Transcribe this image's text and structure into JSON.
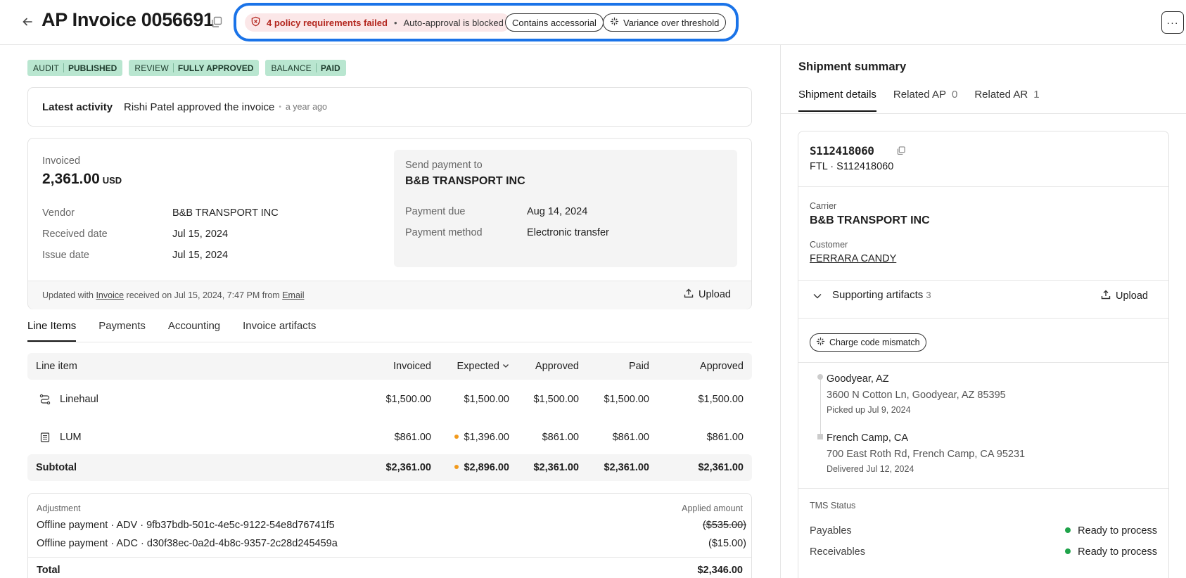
{
  "header": {
    "title": "AP Invoice 0056691",
    "policy_failed": "4 policy requirements failed",
    "auto_approval": "Auto-approval is blocked",
    "chip_accessorial": "Contains accessorial",
    "chip_variance": "Variance over threshold",
    "more_label": "···"
  },
  "badges": [
    {
      "key": "AUDIT",
      "value": "PUBLISHED"
    },
    {
      "key": "REVIEW",
      "value": "FULLY APPROVED"
    },
    {
      "key": "BALANCE",
      "value": "PAID"
    }
  ],
  "activity": {
    "label": "Latest activity",
    "text": "Rishi Patel approved the invoice",
    "time": "a year ago"
  },
  "invoice": {
    "invoiced_label": "Invoiced",
    "amount": "2,361.00",
    "currency": "USD",
    "vendor_label": "Vendor",
    "vendor": "B&B TRANSPORT INC",
    "received_label": "Received date",
    "received": "Jul 15, 2024",
    "issue_label": "Issue date",
    "issue": "Jul 15, 2024",
    "send_to_label": "Send payment to",
    "send_to": "B&B TRANSPORT INC",
    "due_label": "Payment due",
    "due": "Aug 14, 2024",
    "method_label": "Payment method",
    "method": "Electronic transfer",
    "updated_prefix": "Updated with",
    "updated_link": "Invoice",
    "updated_mid": "received on Jul 15, 2024, 7:47 PM from",
    "updated_source": "Email",
    "upload_label": "Upload"
  },
  "tabs": [
    "Line Items",
    "Payments",
    "Accounting",
    "Invoice artifacts"
  ],
  "table": {
    "headers": [
      "Line item",
      "Invoiced",
      "Expected",
      "Approved",
      "Paid",
      "Approved"
    ],
    "rows": [
      {
        "name": "Linehaul",
        "icon": "route-icon",
        "invoiced": "$1,500.00",
        "expected": "$1,500.00",
        "approved": "$1,500.00",
        "paid": "$1,500.00",
        "approved2": "$1,500.00"
      },
      {
        "name": "LUM",
        "icon": "receipt-icon",
        "invoiced": "$861.00",
        "expected": "$1,396.00",
        "approved": "$861.00",
        "paid": "$861.00",
        "approved2": "$861.00"
      }
    ],
    "subtotal": {
      "label": "Subtotal",
      "invoiced": "$2,361.00",
      "expected": "$2,896.00",
      "approved": "$2,361.00",
      "paid": "$2,361.00",
      "approved2": "$2,361.00"
    }
  },
  "adjustments": {
    "header_left": "Adjustment",
    "header_right": "Applied amount",
    "items": [
      {
        "desc": "Offline payment · ADV · 9fb37bdb-501c-4e5c-9122-54e8d76741f5",
        "amount": "($535.00)"
      },
      {
        "desc": "Offline payment · ADC · d30f38ec-0a2d-4b8c-9357-2c28d245459a",
        "amount": "($15.00)"
      }
    ],
    "total_label": "Total",
    "total": "$2,346.00"
  },
  "shipment": {
    "title": "Shipment summary",
    "tabs": [
      {
        "label": "Shipment details",
        "count": ""
      },
      {
        "label": "Related AP",
        "count": "0"
      },
      {
        "label": "Related AR",
        "count": "1"
      }
    ],
    "id": "S112418060",
    "mode_line": "FTL · S112418060",
    "carrier_label": "Carrier",
    "carrier": "B&B TRANSPORT INC",
    "customer_label": "Customer",
    "customer": "FERRARA CANDY",
    "artifacts_label": "Supporting artifacts",
    "artifacts_count": "3",
    "upload_label": "Upload",
    "charge_chip": "Charge code mismatch",
    "stops": [
      {
        "city": "Goodyear, AZ",
        "address": "3600 N Cotton Ln, Goodyear, AZ 85395",
        "note": "Picked up Jul 9, 2024"
      },
      {
        "city": "French Camp, CA",
        "address": "700 East Roth Rd, French Camp, CA 95231",
        "note": "Delivered Jul 12, 2024"
      }
    ],
    "tms_label": "TMS Status",
    "payables_label": "Payables",
    "payables_status": "Ready to process",
    "receivables_label": "Receivables",
    "receivables_status": "Ready to process"
  }
}
